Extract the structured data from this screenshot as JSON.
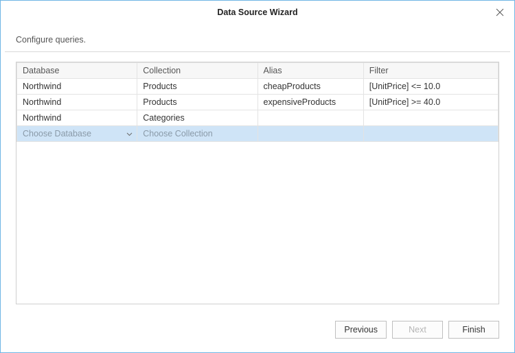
{
  "titlebar": {
    "title": "Data Source Wizard"
  },
  "subtitle": "Configure queries.",
  "grid": {
    "headers": {
      "database": "Database",
      "collection": "Collection",
      "alias": "Alias",
      "filter": "Filter"
    },
    "rows": [
      {
        "database": "Northwind",
        "collection": "Products",
        "alias": "cheapProducts",
        "filter": "[UnitPrice] <= 10.0"
      },
      {
        "database": "Northwind",
        "collection": "Products",
        "alias": "expensiveProducts",
        "filter": "[UnitPrice] >= 40.0"
      },
      {
        "database": "Northwind",
        "collection": "Categories",
        "alias": "",
        "filter": ""
      }
    ],
    "newRow": {
      "databasePlaceholder": "Choose Database",
      "collectionPlaceholder": "Choose Collection"
    }
  },
  "footer": {
    "previous": "Previous",
    "next": "Next",
    "finish": "Finish"
  }
}
